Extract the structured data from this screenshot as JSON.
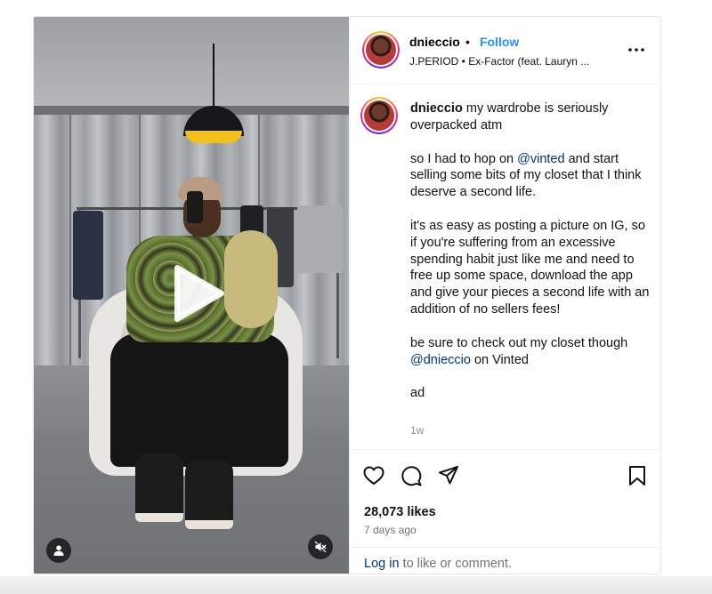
{
  "header": {
    "username": "dnieccio",
    "separator": "•",
    "follow_label": "Follow",
    "audio": "J.PERIOD • Ex-Factor (feat. Lauryn ..."
  },
  "caption": {
    "username": "dnieccio",
    "line1": "my wardrobe is seriously overpacked atm",
    "p2_before": "so I had to hop on ",
    "p2_mention": "@vinted",
    "p2_after": " and start selling some bits of my closet that I think deserve a second life.",
    "p3": "it's as easy as posting a picture on IG, so if you're suffering from an excessive spending habit just like me and need to free up some space, download the app and give your pieces a second life with an addition of no sellers fees!",
    "p4_before": "be sure to check out my closet though ",
    "p4_mention": "@dnieccio",
    "p4_after": " on Vinted",
    "p5": "ad",
    "timestamp": "1w"
  },
  "stats": {
    "likes": "28,073 likes",
    "posted": "7 days ago"
  },
  "login": {
    "link": "Log in",
    "rest": " to like or comment."
  },
  "icons": {
    "more": "more-options-icon",
    "like": "heart-icon",
    "comment": "comment-icon",
    "share": "share-icon",
    "save": "bookmark-icon",
    "play": "play-icon",
    "user_tag": "user-tag-icon",
    "mute": "muted-speaker-icon"
  },
  "colors": {
    "follow": "#2b8ef5",
    "mention": "#00376b",
    "muted_text": "#737373"
  }
}
